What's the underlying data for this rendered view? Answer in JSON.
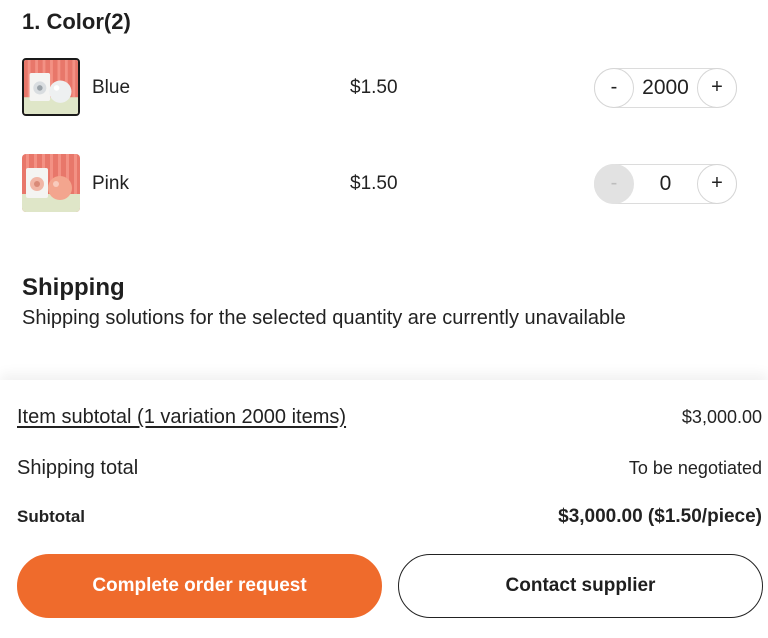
{
  "section": {
    "title": "1. Color(2)"
  },
  "variants": [
    {
      "name": "Blue",
      "price": "$1.50",
      "quantity": "2000",
      "minus_label": "-",
      "plus_label": "+",
      "selected": true,
      "minus_disabled": false
    },
    {
      "name": "Pink",
      "price": "$1.50",
      "quantity": "0",
      "minus_label": "-",
      "plus_label": "+",
      "selected": false,
      "minus_disabled": true
    }
  ],
  "shipping": {
    "title": "Shipping",
    "note": "Shipping solutions for the selected quantity are currently unavailable"
  },
  "summary": {
    "item_subtotal_label": "Item subtotal (1 variation 2000 items)",
    "item_subtotal_value": "$3,000.00",
    "shipping_total_label": "Shipping total",
    "shipping_total_value": "To be negotiated",
    "subtotal_label": "Subtotal",
    "subtotal_value": "$3,000.00 ($1.50/piece)"
  },
  "actions": {
    "primary_label": "Complete order request",
    "secondary_label": "Contact supplier"
  },
  "colors": {
    "accent": "#ef6b2c",
    "text": "#222222",
    "disabled": "#e2e2e2"
  }
}
